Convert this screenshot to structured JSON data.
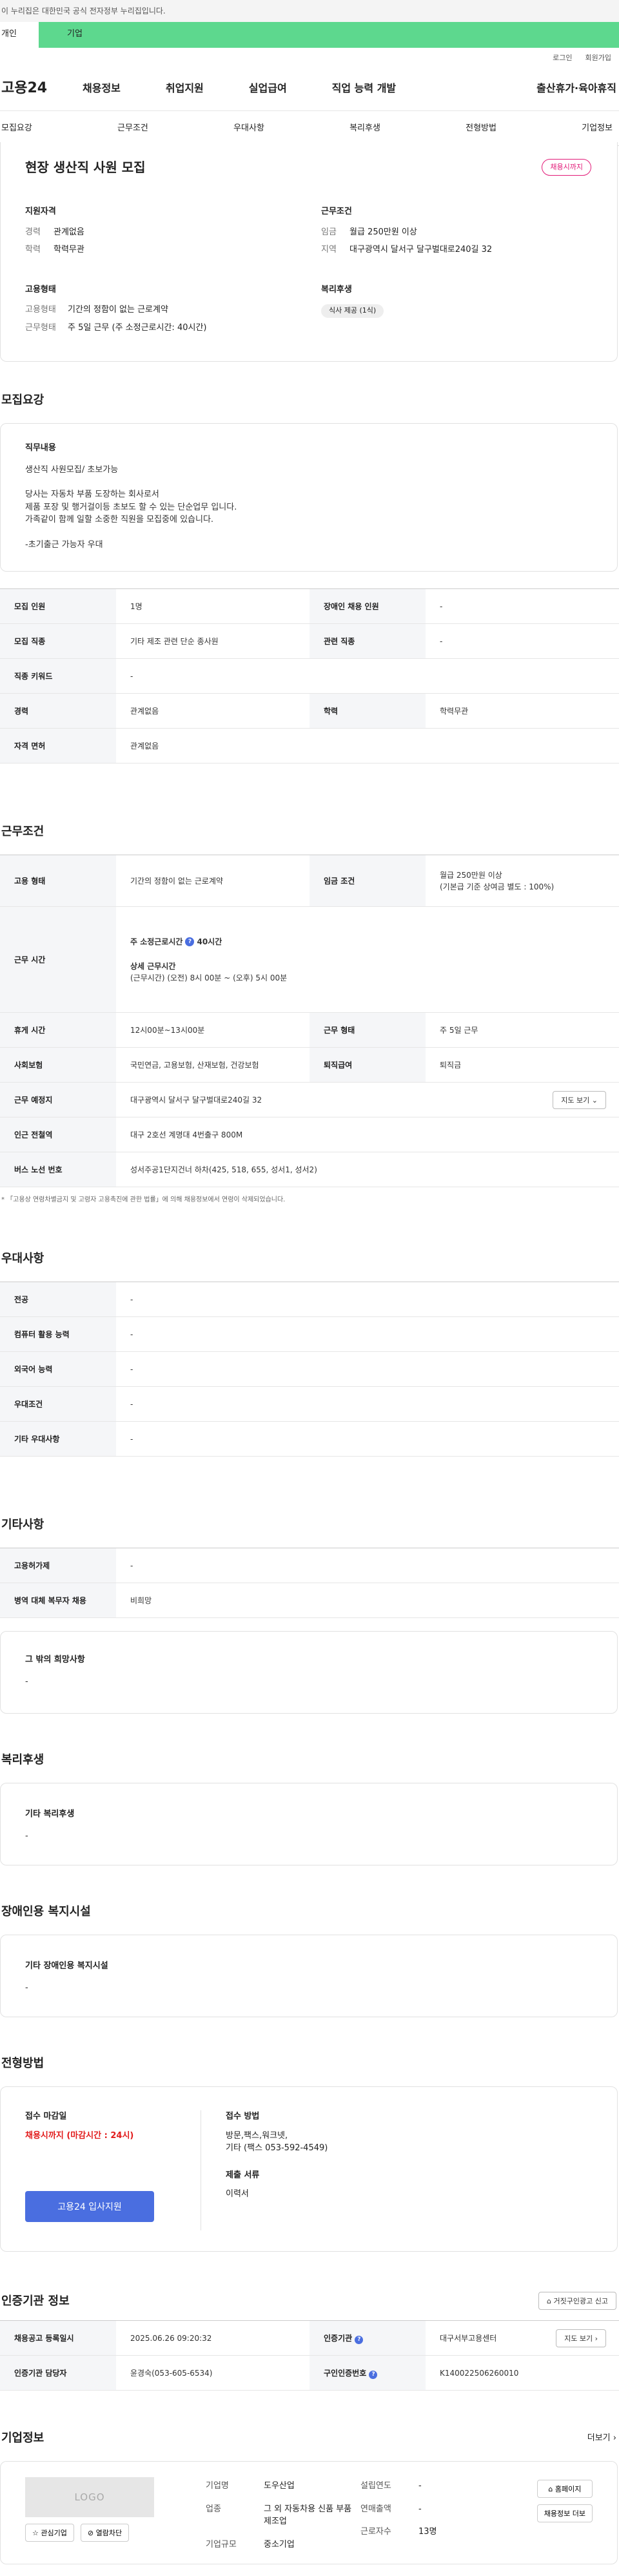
{
  "notice": "이 누리집은 대한민국 공식 전자정부 누리집입니다.",
  "user_tabs": [
    "개인",
    "기업"
  ],
  "util": {
    "login": "로그인",
    "join": "회원가입"
  },
  "logo": "고용24",
  "gnb": [
    "채용정보",
    "취업지원",
    "실업급여",
    "직업 능력 개발",
    "출산휴가·육아휴직"
  ],
  "subtabs": [
    "모집요강",
    "근무조건",
    "우대사항",
    "복리후생",
    "전형방법",
    "기업정보"
  ],
  "summary": {
    "title": "현장 생산직 사원 모집",
    "badge": "채용시까지",
    "qual": {
      "title": "지원자격",
      "rows": [
        {
          "k": "경력",
          "v": "관계없음"
        },
        {
          "k": "학력",
          "v": "학력무관"
        }
      ]
    },
    "cond": {
      "title": "근무조건",
      "rows": [
        {
          "k": "임금",
          "v": "월급 250만원 이상"
        },
        {
          "k": "지역",
          "v": "대구광역시 달서구 달구벌대로240길 32"
        }
      ]
    },
    "emp": {
      "title": "고용형태",
      "rows": [
        {
          "k": "고용형태",
          "v": "기간의 정함이 없는 근로계약"
        },
        {
          "k": "근무형태",
          "v": "주 5일 근무 (주 소정근로시간: 40시간)"
        }
      ]
    },
    "welfare": {
      "title": "복리후생",
      "chip": "식사 제공 (1식)"
    }
  },
  "recruit": {
    "title": "모집요강",
    "job_title": "직무내용",
    "job_lines": [
      "생산직 사원모집/ 초보가능",
      "",
      "당사는 자동차 부품 도장하는 회사로서",
      "제품 포장 및 행거걸이등 초보도 할 수 있는 단순업무 입니다.",
      "가족같이 함께 일할 소중한 직원을 모집중에 있습니다.",
      "",
      "-초기출근 가능자 우대"
    ],
    "rows": [
      {
        "k1": "모집 인원",
        "v1": "1명",
        "k2": "장애인 채용 인원",
        "v2": "-"
      },
      {
        "k1": "모집 직종",
        "v1": "기타 제조 관련 단순 종사원",
        "k2": "관련 직종",
        "v2": "-"
      },
      {
        "k1": "직종 키워드",
        "v1": "-"
      },
      {
        "k1": "경력",
        "v1": "관계없음",
        "k2": "학력",
        "v2": "학력무관"
      },
      {
        "k1": "자격 면허",
        "v1": "관계없음"
      }
    ]
  },
  "work": {
    "title": "근무조건",
    "emp_type_k": "고용 형태",
    "emp_type_v": "기간의 정함이 없는 근로계약",
    "wage_k": "임금 조건",
    "wage_v1": "월급 250만원 이상",
    "wage_v2": "(기본급 기준 상여금 별도 : 100%)",
    "hours_k": "근무 시간",
    "hours_label": "주 소정근로시간",
    "hours_value": "40시간",
    "detail_label": "상세 근무시간",
    "detail_value": "(근무시간) (오전) 8시 00분 ~ (오후) 5시 00분",
    "rest_k": "휴게 시간",
    "rest_v": "12시00분~13시00분",
    "form_k": "근무 형태",
    "form_v": "주 5일 근무",
    "ins_k": "사회보험",
    "ins_v": "국민연금, 고용보험, 산재보험, 건강보험",
    "sev_k": "퇴직급여",
    "sev_v": "퇴직금",
    "place_k": "근무 예정지",
    "place_v": "대구광역시 달서구 달구벌대로240길 32",
    "map_btn": "지도 보기",
    "subway_k": "인근 전철역",
    "subway_v": "대구 2호선 계명대 4번출구 800M",
    "bus_k": "버스 노선 번호",
    "bus_v": "성서주공1단지건너 하차(425, 518, 655, 성서1, 성서2)",
    "note": "「고용상 연령차별금지 및 고령자 고용촉진에 관한 법률」에 의해 채용정보에서 연령이 삭제되었습니다."
  },
  "pref": {
    "title": "우대사항",
    "rows": [
      {
        "k": "전공",
        "v": "-"
      },
      {
        "k": "컴퓨터 활용 능력",
        "v": "-"
      },
      {
        "k": "외국어 능력",
        "v": "-"
      },
      {
        "k": "우대조건",
        "v": "-"
      },
      {
        "k": "기타 우대사항",
        "v": "-"
      }
    ]
  },
  "etc": {
    "title": "기타사항",
    "rows": [
      {
        "k": "고용허가제",
        "v": "-"
      },
      {
        "k": "병역 대체 복무자 채용",
        "v": "비희망"
      }
    ],
    "other_title": "그 밖의 희망사항",
    "other_value": "-"
  },
  "benefit": {
    "title": "복리후생",
    "box_title": "기타 복리후생",
    "box_value": "-"
  },
  "disabled": {
    "title": "장애인용 복지시설",
    "box_title": "기타 장애인용 복지시설",
    "box_value": "-"
  },
  "apply": {
    "title": "전형방법",
    "deadline_label": "접수 마감일",
    "deadline_value": "채용시까지 (마감시간 : 24시)",
    "method_label": "접수 방법",
    "method_lines": [
      "방문,팩스,워크넷,",
      "기타 (팩스 053-592-4549)"
    ],
    "docs_label": "제출 서류",
    "docs_value": "이력서",
    "apply_btn": "고용24 입사지원"
  },
  "cert": {
    "title": "인증기관 정보",
    "report_btn": "거짓구인광고 신고",
    "reg_k": "채용공고 등록일시",
    "reg_v": "2025.06.26 09:20:32",
    "org_k": "인증기관",
    "org_v": "대구서부고용센터",
    "map_btn": "지도 보기",
    "mgr_k": "인증기관 담당자",
    "mgr_v": "윤경숙(053-605-6534)",
    "no_k": "구인인증번호",
    "no_v": "K140022506260010"
  },
  "corp": {
    "title": "기업정보",
    "more": "더보기",
    "logo_text": "LOGO",
    "fav_btn": "관심기업",
    "block_btn": "열람차단",
    "name_k": "기업명",
    "name_v": "도우산업",
    "ind_k": "업종",
    "ind_v": "그 외 자동차용 신품 부품 제조업",
    "size_k": "기업규모",
    "size_v": "중소기업",
    "year_k": "설립연도",
    "year_v": "-",
    "sales_k": "연매출액",
    "sales_v": "-",
    "emp_k": "근로자수",
    "emp_v": "13명",
    "home_btn": "홈페이지",
    "list_btn": "채용정보 더보"
  }
}
